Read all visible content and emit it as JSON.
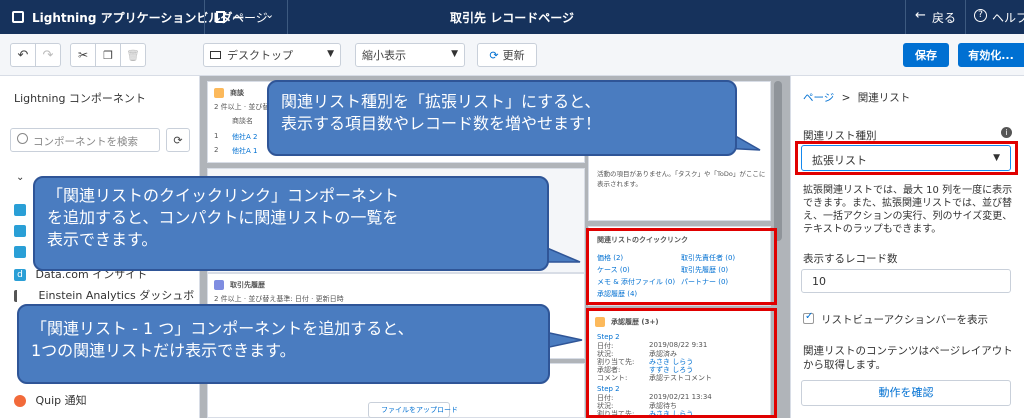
{
  "topbar": {
    "app_title": "Lightning アプリケーションビルダー",
    "page_menu": "ページ",
    "record_title": "取引先 レコードページ",
    "back": "戻る",
    "help": "ヘルプ"
  },
  "toolbar": {
    "device_select": "デスクトップ",
    "view_select": "縮小表示",
    "refresh": "更新",
    "save": "保存",
    "activate": "有効化..."
  },
  "left_panel": {
    "title": "Lightning コンポーネント",
    "search_placeholder": "コンポーネントを検索",
    "items": [
      {
        "label": "Data.com インサイト",
        "icon": "data-icon"
      },
      {
        "label": "Einstein Analytics ダッシュボ",
        "icon": "chart-icon"
      },
      {
        "label": "Quip 通知",
        "icon": "quip-icon"
      }
    ]
  },
  "canvas": {
    "top_card_title": "商談",
    "top_card_sub": "2 件以上 · 並び替え基準: 完了予定日",
    "col_header": "商談名",
    "rows": [
      "他社A 2",
      "他社A 1"
    ],
    "feed_text": "活動の項目がありません。「タスク」や「ToDo」がここに表示されます。",
    "deal_card_title": "取引先履歴",
    "deal_card_sub": "2 件以上 · 並び替え基準: 日付 · 更新日時",
    "quicklinks_title": "関連リストのクイックリンク",
    "quicklinks": [
      "価格 (2)",
      "取引先責任者 (0)",
      "ケース (0)",
      "取引先履歴 (0)",
      "メモ & 添付ファイル (0)",
      "パートナー (0)",
      "承認履歴 (4)"
    ],
    "approval_title": "承認履歴 (3+)",
    "approval_entries": [
      {
        "step": "Step 2",
        "date_label": "日付:",
        "date": "2019/08/22 9:31",
        "status_label": "状況:",
        "status": "承認済み",
        "assign_label": "割り当て先:",
        "assign": "みさき しらう",
        "approver_label": "承認者:",
        "approver": "すずき しろう",
        "comment_label": "コメント:",
        "comment": "承認テストコメント"
      },
      {
        "step": "Step 2",
        "date_label": "日付:",
        "date": "2019/02/21 13:34",
        "status_label": "状況:",
        "status": "承認待ち",
        "assign_label": "割り当て先:",
        "assign": "みさき しらう",
        "approver_label": "",
        "approver": "",
        "comment_label": "",
        "comment": ""
      }
    ],
    "upload_btn": "ファイルをアップロード"
  },
  "right_panel": {
    "breadcrumb_root": "ページ",
    "breadcrumb_sep": ">",
    "breadcrumb_current": "関連リスト",
    "type_label": "関連リスト種別",
    "type_value": "拡張リスト",
    "description": "拡張関連リストでは、最大 10 列を一度に表示できます。また、拡張関連リストでは、並び替え、一括アクションの実行、列のサイズ変更、テキストのラップもできます。",
    "records_label": "表示するレコード数",
    "records_value": "10",
    "checkbox_label": "リストビューアクションバーを表示",
    "layout_note": "関連リストのコンテンツはページレイアウトから取得します。",
    "confirm_button": "動作を確認"
  },
  "callouts": {
    "top": [
      "関連リスト種別を「拡張リスト」にすると、",
      "表示する項目数やレコード数を増やせます！"
    ],
    "middle": [
      "「関連リストのクイックリンク」コンポーネント",
      "を追加すると、コンパクトに関連リストの一覧を",
      "表示できます。"
    ],
    "bottom": [
      "「関連リスト - 1 つ」コンポーネントを追加すると、",
      "1つの関連リストだけ表示できます。"
    ]
  },
  "colors": {
    "topbar": "#16325c",
    "accent_blue": "#0070d2",
    "callout": "#4a7cc0",
    "highlight_red": "#e00000"
  }
}
